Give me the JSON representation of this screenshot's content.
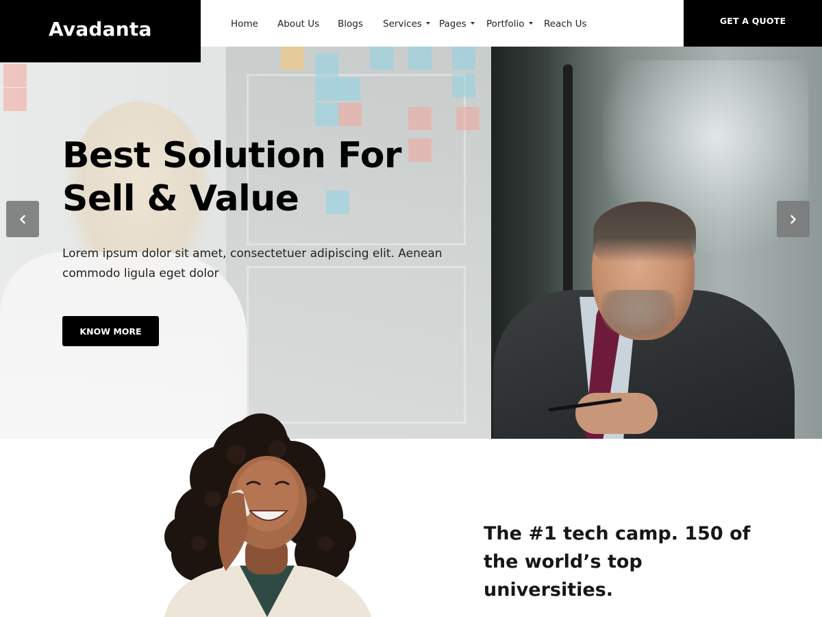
{
  "header": {
    "logo": "Avadanta",
    "nav": [
      {
        "label": "Home",
        "has_dropdown": false
      },
      {
        "label": "About Us",
        "has_dropdown": false
      },
      {
        "label": "Blogs",
        "has_dropdown": false
      },
      {
        "label": "Services",
        "has_dropdown": true
      },
      {
        "label": "Pages",
        "has_dropdown": true
      },
      {
        "label": "Portfolio",
        "has_dropdown": true
      },
      {
        "label": "Reach Us",
        "has_dropdown": false
      }
    ],
    "cta_label": "GET A QUOTE"
  },
  "hero": {
    "title_line1": "Best Solution For",
    "title_line2": "Sell & Value",
    "description_line1": "Lorem ipsum dolor sit amet, consectetuer adipiscing elit. Aenean",
    "description_line2": "commodo ligula eget dolor",
    "button_label": "KNOW MORE",
    "prev_icon": "chevron-left-icon",
    "next_icon": "chevron-right-icon"
  },
  "about": {
    "heading_line1": "The #1 tech camp. 150 of",
    "heading_line2": "the world’s top",
    "heading_line3": "universities."
  },
  "colors": {
    "primary": "#000000",
    "background": "#ffffff",
    "slider_arrow": "#7b7d7d"
  }
}
